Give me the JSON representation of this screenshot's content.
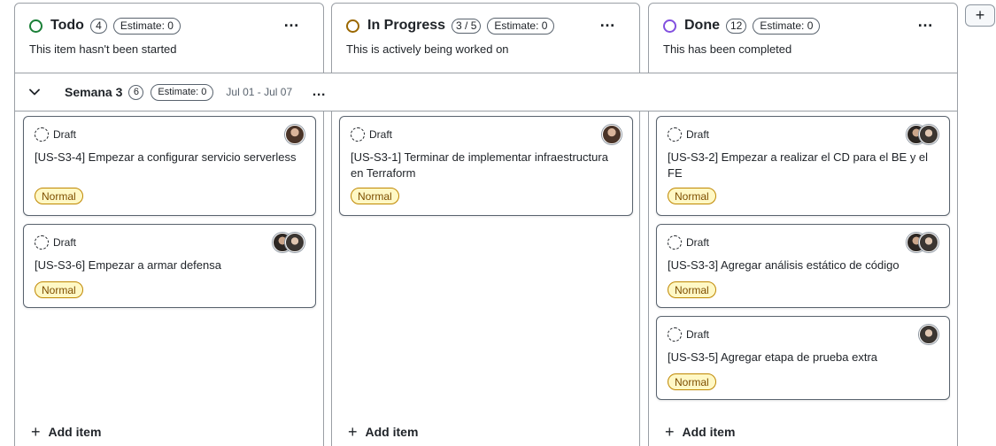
{
  "columns": [
    {
      "name": "Todo",
      "count": "4",
      "estimate": "Estimate: 0",
      "description": "This item hasn't been started",
      "status_color": "#1a7f37",
      "add_item_label": "Add item",
      "cards": [
        {
          "status": "Draft",
          "title": "[US-S3-4] Empezar a configurar servicio serverless",
          "label": "Normal",
          "avatars": [
            "user-avatar"
          ]
        },
        {
          "status": "Draft",
          "title": "[US-S3-6] Empezar a armar defensa",
          "label": "Normal",
          "avatars": [
            "user-avatar",
            "user-avatar"
          ]
        }
      ]
    },
    {
      "name": "In Progress",
      "count": "3 / 5",
      "estimate": "Estimate: 0",
      "description": "This is actively being worked on",
      "status_color": "#9a6700",
      "add_item_label": "Add item",
      "cards": [
        {
          "status": "Draft",
          "title": "[US-S3-1] Terminar de implementar infraestructura en Terraform",
          "label": "Normal",
          "avatars": [
            "user-avatar"
          ]
        }
      ]
    },
    {
      "name": "Done",
      "count": "12",
      "estimate": "Estimate: 0",
      "description": "This has been completed",
      "status_color": "#8250df",
      "add_item_label": "Add item",
      "cards": [
        {
          "status": "Draft",
          "title": "[US-S3-2] Empezar a realizar el CD para el BE y el FE",
          "label": "Normal",
          "avatars": [
            "user-avatar",
            "user-avatar"
          ]
        },
        {
          "status": "Draft",
          "title": "[US-S3-3] Agregar análisis estático de código",
          "label": "Normal",
          "avatars": [
            "user-avatar",
            "user-avatar"
          ]
        },
        {
          "status": "Draft",
          "title": "[US-S3-5] Agregar etapa de prueba extra",
          "label": "Normal",
          "avatars": [
            "user-avatar"
          ]
        }
      ]
    }
  ],
  "group": {
    "title": "Semana 3",
    "count": "6",
    "estimate": "Estimate: 0",
    "dates": "Jul 01 - Jul 07"
  },
  "icons": {
    "menu": "…",
    "plus": "+",
    "add_column": "+"
  },
  "colors": {
    "label_bg": "#fff8c5",
    "label_border": "#bf8700",
    "border": "#9a9fa5"
  }
}
